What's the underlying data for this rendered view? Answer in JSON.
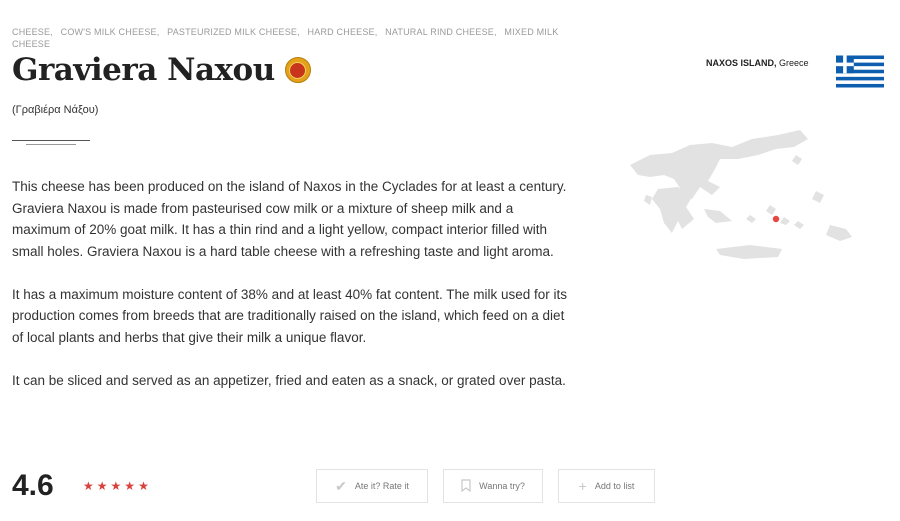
{
  "breadcrumbs": [
    "CHEESE,",
    "COW'S MILK CHEESE,",
    "PASTEURIZED MILK CHEESE,",
    "HARD CHEESE,",
    "NATURAL RIND CHEESE,",
    "MIXED MILK CHEESE"
  ],
  "title": "Graviera Naxou",
  "seal_icon": "pdo-seal-icon",
  "local_name": "(Γραβιέρα Νάξου)",
  "description": [
    "This cheese has been produced on the island of Naxos in the Cyclades for at least a century. Graviera Naxou is made from pasteurised cow milk or a mixture of sheep milk and a maximum of 20% goat milk. It has a thin rind and a light yellow, compact interior filled with small holes. Graviera Naxou is a hard table cheese with a refreshing taste and light aroma.",
    "It has a maximum moisture content of 38% and at least 40% fat content. The milk used for its production comes from breeds that are traditionally raised on the island, which feed on a diet of local plants and herbs that give their milk a unique flavor.",
    "It can be sliced and served as an appetizer, fried and eaten as a snack, or grated over pasta."
  ],
  "origin": {
    "region": "NAXOS ISLAND,",
    "country": "Greece"
  },
  "colors": {
    "accent": "#d9423a",
    "flag_blue": "#0d5eaf",
    "map_fill": "#e2e2e2",
    "map_marker": "#e8473f"
  },
  "rating": {
    "value": "4.6",
    "stars": 5,
    "star_icon": "star-icon"
  },
  "actions": {
    "rate_label": "Ate it? Rate it",
    "rate_icon": "checkmark-icon",
    "wishlist_label": "Wanna try?",
    "wishlist_icon": "bookmark-icon",
    "list_label": "Add to list",
    "list_icon": "plus-icon"
  }
}
